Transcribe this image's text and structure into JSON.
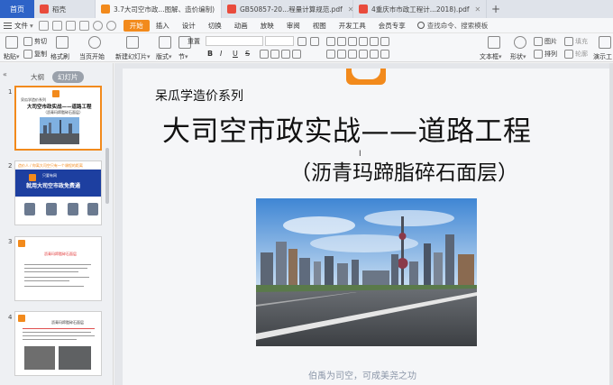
{
  "tabbar": {
    "home_label": "首页",
    "tabs": [
      {
        "label": "稻壳",
        "icon_color": "#e94b3c",
        "active": false
      },
      {
        "label": "3.7大司空市政...图解、造价编制)",
        "icon_color": "#f28a1c",
        "active": true
      },
      {
        "label": "GB50857-20...程量计算规范.pdf",
        "icon_color": "#e94b3c",
        "active": false
      },
      {
        "label": "4重庆市市政工程计...2018).pdf",
        "icon_color": "#e94b3c",
        "active": false
      }
    ],
    "new_tab_symbol": "+"
  },
  "menubar": {
    "file_label": "文件",
    "items": [
      {
        "label": "开始",
        "active": true
      },
      {
        "label": "插入",
        "active": false
      },
      {
        "label": "设计",
        "active": false
      },
      {
        "label": "切换",
        "active": false
      },
      {
        "label": "动画",
        "active": false
      },
      {
        "label": "放映",
        "active": false
      },
      {
        "label": "审阅",
        "active": false
      },
      {
        "label": "视图",
        "active": false
      },
      {
        "label": "开发工具",
        "active": false
      },
      {
        "label": "会员专享",
        "active": false
      }
    ],
    "search_placeholder": "查找命令、搜索模板"
  },
  "toolbar": {
    "paste": "粘贴",
    "cut": "剪切",
    "copy": "复制",
    "format_painter": "格式刷",
    "play_from_current": "当页开始",
    "new_slide": "新建幻灯片",
    "layout": "版式",
    "section": "节",
    "reset": "重置",
    "textbox": "文本框",
    "shape": "形状",
    "arrange": "排列",
    "picture": "图片",
    "fill": "填充",
    "outline": "轮廓",
    "present": "演示工",
    "format_bold": "B",
    "format_italic": "I",
    "format_underline": "U",
    "format_strike": "S"
  },
  "leftpanel": {
    "collapse_symbol": "«",
    "view_outline": "大纲",
    "view_slides": "幻灯片",
    "slides": [
      {
        "number": "1",
        "title_line1": "大司空市政实战——道路工程",
        "title_line2": "（沥青玛蹄脂碎石面层）",
        "brand": "呆瓜学造价系列"
      },
      {
        "number": "2",
        "headline": "就用大司空市政免费通",
        "subline": "只要有网",
        "banner": "造价人 / 你离大司空只有一个课程的距离"
      },
      {
        "number": "3",
        "heading": "沥青玛蹄脂碎石面层"
      },
      {
        "number": "4",
        "heading": "沥青玛蹄脂碎石面层"
      }
    ]
  },
  "slide": {
    "brand": "呆瓜学造价系列",
    "title": "大司空市政实战——道路工程",
    "subtitle": "（沥青玛蹄脂碎石面层）",
    "footer": "伯禹为司空，可成美尧之功",
    "cursor": "I"
  },
  "colors": {
    "accent": "#f28a1c",
    "home_tab": "#2e63c7"
  }
}
